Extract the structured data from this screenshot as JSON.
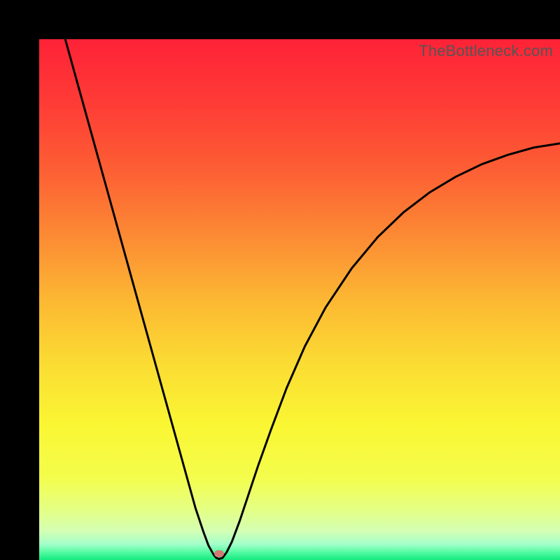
{
  "watermark": "TheBottleneck.com",
  "colors": {
    "border": "#000000",
    "gradient_stops": [
      {
        "pos": 0.0,
        "color": "#fe2237"
      },
      {
        "pos": 0.12,
        "color": "#fe3b36"
      },
      {
        "pos": 0.25,
        "color": "#fd5e34"
      },
      {
        "pos": 0.38,
        "color": "#fc8b34"
      },
      {
        "pos": 0.5,
        "color": "#fcb733"
      },
      {
        "pos": 0.62,
        "color": "#fbdb33"
      },
      {
        "pos": 0.74,
        "color": "#faf633"
      },
      {
        "pos": 0.84,
        "color": "#f4fd4b"
      },
      {
        "pos": 0.905,
        "color": "#e4ff86"
      },
      {
        "pos": 0.945,
        "color": "#d3ffb5"
      },
      {
        "pos": 0.97,
        "color": "#a2ffc9"
      },
      {
        "pos": 0.985,
        "color": "#54fba2"
      },
      {
        "pos": 1.0,
        "color": "#15e97f"
      }
    ],
    "curve": "#000000",
    "marker": "#cf7a74"
  },
  "chart_data": {
    "type": "line",
    "title": "",
    "xlabel": "",
    "ylabel": "",
    "xlim": [
      0,
      1
    ],
    "ylim": [
      0,
      1
    ],
    "grid": false,
    "legend": false,
    "x": [
      0.05,
      0.075,
      0.1,
      0.125,
      0.15,
      0.175,
      0.2,
      0.225,
      0.25,
      0.275,
      0.3,
      0.315,
      0.325,
      0.335,
      0.34,
      0.345,
      0.352,
      0.36,
      0.37,
      0.385,
      0.4,
      0.42,
      0.445,
      0.475,
      0.51,
      0.55,
      0.6,
      0.65,
      0.7,
      0.75,
      0.8,
      0.85,
      0.9,
      0.95,
      1.0
    ],
    "y": [
      1.0,
      0.91,
      0.82,
      0.73,
      0.64,
      0.55,
      0.46,
      0.37,
      0.28,
      0.19,
      0.1,
      0.055,
      0.028,
      0.01,
      0.004,
      0.002,
      0.004,
      0.015,
      0.035,
      0.075,
      0.12,
      0.18,
      0.25,
      0.33,
      0.41,
      0.485,
      0.56,
      0.62,
      0.668,
      0.706,
      0.736,
      0.76,
      0.778,
      0.792,
      0.8
    ],
    "marker": {
      "x": 0.345,
      "y": 0.012
    },
    "description": "V-shaped bottleneck curve: steep linear descent from top-left to a minimum near x≈0.345, then a decelerating ascent approaching y≈0.8 at x=1. Background is a vertical rainbow gradient from red (high y / top) through orange, yellow, pale-yellow, pale-green to green (low y / bottom)."
  }
}
